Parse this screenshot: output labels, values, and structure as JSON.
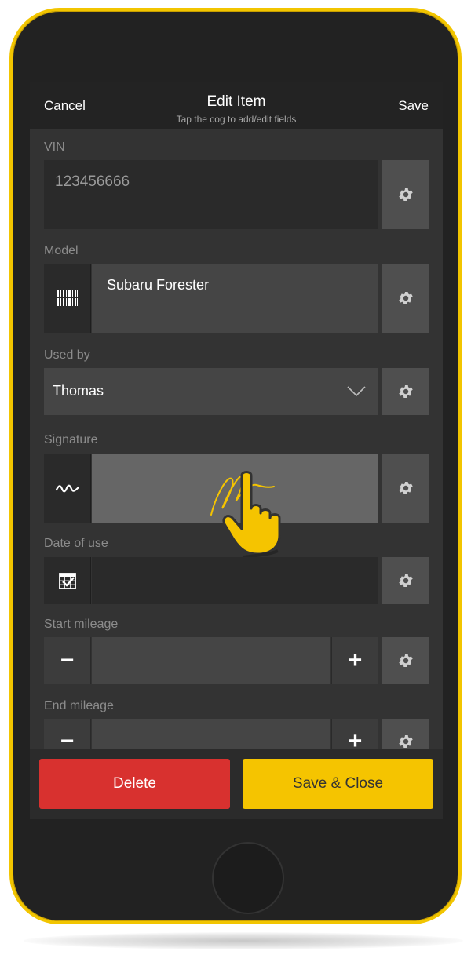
{
  "navbar": {
    "cancel_label": "Cancel",
    "title": "Edit Item",
    "subtitle": "Tap the cog to add/edit fields",
    "save_label": "Save"
  },
  "fields": {
    "vin": {
      "label": "VIN",
      "value": "123456666"
    },
    "model": {
      "label": "Model",
      "value": "Subaru Forester"
    },
    "used_by": {
      "label": "Used by",
      "value": "Thomas"
    },
    "signature": {
      "label": "Signature"
    },
    "date_of_use": {
      "label": "Date of use",
      "value": ""
    },
    "start_mileage": {
      "label": "Start mileage",
      "minus": "−",
      "plus": "+"
    },
    "end_mileage": {
      "label": "End mileage",
      "minus": "−",
      "plus": "+"
    }
  },
  "footer": {
    "delete_label": "Delete",
    "save_close_label": "Save & Close"
  },
  "colors": {
    "phone_frame": "#f2c500",
    "accent_yellow": "#f5c400",
    "delete_red": "#d8312f"
  },
  "icons": [
    "gear-icon",
    "barcode-icon",
    "chevron-down-icon",
    "signature-icon",
    "calendar-check-icon",
    "tap-hand-icon"
  ]
}
